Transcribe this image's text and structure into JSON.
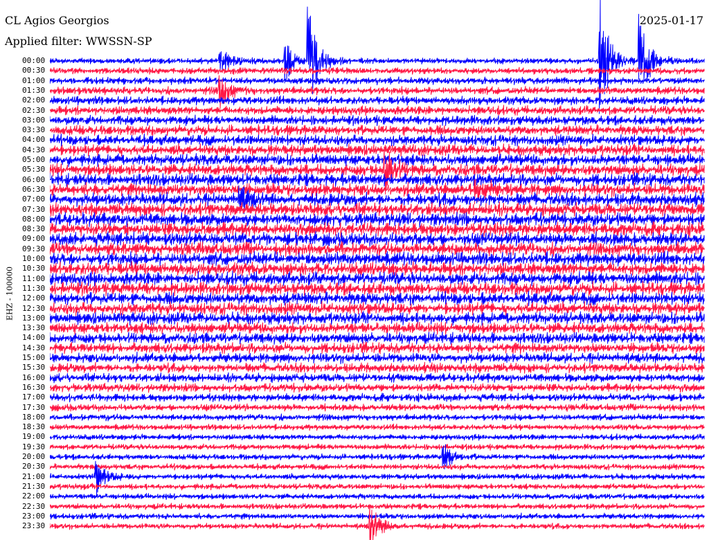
{
  "header": {
    "station": "CL Agios Georgios",
    "filter": "Applied filter: WWSSN-SP",
    "date": "2025-01-17"
  },
  "chart_data": {
    "type": "line",
    "title": "CL Agios Georgios",
    "subtitle": "Applied filter: WWSSN-SP",
    "date": "2025-01-17",
    "ylabel": "EHZ - 100000",
    "colors": [
      "#0000ff",
      "#ff1744"
    ],
    "rows": [
      "00:00",
      "00:30",
      "01:00",
      "01:30",
      "02:00",
      "02:30",
      "03:00",
      "03:30",
      "04:00",
      "04:30",
      "05:00",
      "05:30",
      "06:00",
      "06:30",
      "07:00",
      "07:30",
      "08:00",
      "08:30",
      "09:00",
      "09:30",
      "10:00",
      "10:30",
      "11:00",
      "11:30",
      "12:00",
      "12:30",
      "13:00",
      "13:30",
      "14:00",
      "14:30",
      "15:00",
      "15:30",
      "16:00",
      "16:30",
      "17:00",
      "17:30",
      "18:00",
      "18:30",
      "19:00",
      "19:30",
      "20:00",
      "20:30",
      "21:00",
      "21:30",
      "22:00",
      "22:30",
      "23:00",
      "23:30"
    ],
    "events": [
      {
        "row": 0,
        "x_frac": 0.26,
        "amp": 24
      },
      {
        "row": 0,
        "x_frac": 0.395,
        "amp": 85
      },
      {
        "row": 0,
        "x_frac": 0.36,
        "amp": 30
      },
      {
        "row": 0,
        "x_frac": 0.84,
        "amp": 95
      },
      {
        "row": 0,
        "x_frac": 0.9,
        "amp": 80
      },
      {
        "row": 3,
        "x_frac": 0.26,
        "amp": 25
      },
      {
        "row": 11,
        "x_frac": 0.51,
        "amp": 40
      },
      {
        "row": 13,
        "x_frac": 0.65,
        "amp": 22
      },
      {
        "row": 14,
        "x_frac": 0.29,
        "amp": 18
      },
      {
        "row": 40,
        "x_frac": 0.6,
        "amp": 22
      },
      {
        "row": 42,
        "x_frac": 0.07,
        "amp": 26
      },
      {
        "row": 47,
        "x_frac": 0.49,
        "amp": 34
      }
    ]
  }
}
